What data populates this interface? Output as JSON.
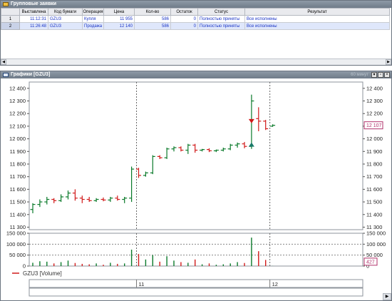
{
  "orders_window": {
    "title": "Групповые заявки",
    "columns": [
      "",
      "Выставлена",
      "Код бумаги",
      "Операция",
      "Цена",
      "Кол-во",
      "Остаток",
      "Статус",
      "Результат"
    ],
    "rows": [
      {
        "n": "1",
        "time": "11:12:31",
        "code": "GZU3",
        "op": "Купля",
        "price": "11 955",
        "qty": "586",
        "rest": "0",
        "status": "Полностью приняты",
        "result": "Все исполнены"
      },
      {
        "n": "2",
        "time": "11:26:48",
        "code": "GZU3",
        "op": "Продажа",
        "price": "12 140",
        "qty": "586",
        "rest": "0",
        "status": "Полностью приняты",
        "result": "Все исполнены"
      }
    ]
  },
  "chart_window": {
    "title": "Графики [GZU3]",
    "title_right": "60 минут",
    "legend": "GZU3 [Volume]",
    "date_labels": [
      "11",
      "12"
    ],
    "price_badge": "12 107",
    "volume_badge": "427",
    "colors": {
      "bull": "#0a7a2a",
      "bear": "#d11a1a",
      "badge": "#b0306a"
    }
  },
  "chart_data": [
    {
      "type": "candlestick",
      "series": "GZU3",
      "ylim": [
        11280,
        12450
      ],
      "yticks": [
        11300,
        11400,
        11500,
        11600,
        11700,
        11800,
        11900,
        12000,
        12100,
        12200,
        12300,
        12400
      ],
      "ytick_labels": [
        "11 300",
        "11 400",
        "11 500",
        "11 600",
        "11 700",
        "11 800",
        "11 900",
        "12 000",
        "12 100",
        "12 200",
        "12 300",
        "12 400"
      ],
      "bars": [
        {
          "o": 11440,
          "h": 11490,
          "l": 11410,
          "c": 11480
        },
        {
          "o": 11480,
          "h": 11520,
          "l": 11460,
          "c": 11500
        },
        {
          "o": 11500,
          "h": 11540,
          "l": 11480,
          "c": 11520
        },
        {
          "o": 11520,
          "h": 11530,
          "l": 11490,
          "c": 11510
        },
        {
          "o": 11510,
          "h": 11560,
          "l": 11500,
          "c": 11540
        },
        {
          "o": 11540,
          "h": 11590,
          "l": 11520,
          "c": 11570
        },
        {
          "o": 11570,
          "h": 11600,
          "l": 11510,
          "c": 11530
        },
        {
          "o": 11530,
          "h": 11550,
          "l": 11490,
          "c": 11520
        },
        {
          "o": 11520,
          "h": 11540,
          "l": 11500,
          "c": 11510
        },
        {
          "o": 11510,
          "h": 11530,
          "l": 11500,
          "c": 11520
        },
        {
          "o": 11520,
          "h": 11535,
          "l": 11505,
          "c": 11515
        },
        {
          "o": 11515,
          "h": 11540,
          "l": 11500,
          "c": 11530
        },
        {
          "o": 11530,
          "h": 11550,
          "l": 11510,
          "c": 11520
        },
        {
          "o": 11520,
          "h": 11540,
          "l": 11490,
          "c": 11530
        },
        {
          "o": 11530,
          "h": 11780,
          "l": 11500,
          "c": 11760
        },
        {
          "o": 11760,
          "h": 11770,
          "l": 11690,
          "c": 11710
        },
        {
          "o": 11710,
          "h": 11740,
          "l": 11700,
          "c": 11730
        },
        {
          "o": 11730,
          "h": 11870,
          "l": 11720,
          "c": 11860
        },
        {
          "o": 11860,
          "h": 11870,
          "l": 11840,
          "c": 11850
        },
        {
          "o": 11850,
          "h": 11930,
          "l": 11840,
          "c": 11920
        },
        {
          "o": 11920,
          "h": 11940,
          "l": 11900,
          "c": 11930
        },
        {
          "o": 11930,
          "h": 11940,
          "l": 11900,
          "c": 11910
        },
        {
          "o": 11910,
          "h": 11960,
          "l": 11880,
          "c": 11950
        },
        {
          "o": 11950,
          "h": 11960,
          "l": 11890,
          "c": 11910
        },
        {
          "o": 11910,
          "h": 11920,
          "l": 11900,
          "c": 11915
        },
        {
          "o": 11915,
          "h": 11925,
          "l": 11895,
          "c": 11905
        },
        {
          "o": 11905,
          "h": 11915,
          "l": 11895,
          "c": 11910
        },
        {
          "o": 11910,
          "h": 11930,
          "l": 11900,
          "c": 11920
        },
        {
          "o": 11920,
          "h": 11960,
          "l": 11910,
          "c": 11950
        },
        {
          "o": 11950,
          "h": 11970,
          "l": 11930,
          "c": 11960
        },
        {
          "o": 11960,
          "h": 11975,
          "l": 11925,
          "c": 11940
        },
        {
          "o": 11940,
          "h": 12350,
          "l": 11920,
          "c": 12300
        },
        {
          "o": 12160,
          "h": 12250,
          "l": 12060,
          "c": 12140
        },
        {
          "o": 12140,
          "h": 12150,
          "l": 12070,
          "c": 12080
        },
        {
          "o": 12100,
          "h": 12115,
          "l": 12095,
          "c": 12107
        }
      ],
      "trades": [
        {
          "bar": 31,
          "price": 11955,
          "side": "buy"
        },
        {
          "bar": 31,
          "price": 12140,
          "side": "sell"
        }
      ]
    },
    {
      "type": "bar",
      "series": "GZU3 [Volume]",
      "ylim": [
        0,
        150000
      ],
      "yticks": [
        0,
        50000,
        100000,
        150000
      ],
      "ytick_labels": [
        "0",
        "50 000",
        "100 000",
        "150 000"
      ],
      "values": [
        15000,
        22000,
        20000,
        12000,
        18000,
        25000,
        14000,
        10000,
        8000,
        12000,
        6000,
        15000,
        10000,
        12000,
        75000,
        55000,
        30000,
        50000,
        20000,
        45000,
        25000,
        18000,
        15000,
        30000,
        8000,
        12000,
        6000,
        8000,
        12000,
        18000,
        14000,
        130000,
        68000,
        28000,
        427
      ]
    }
  ]
}
